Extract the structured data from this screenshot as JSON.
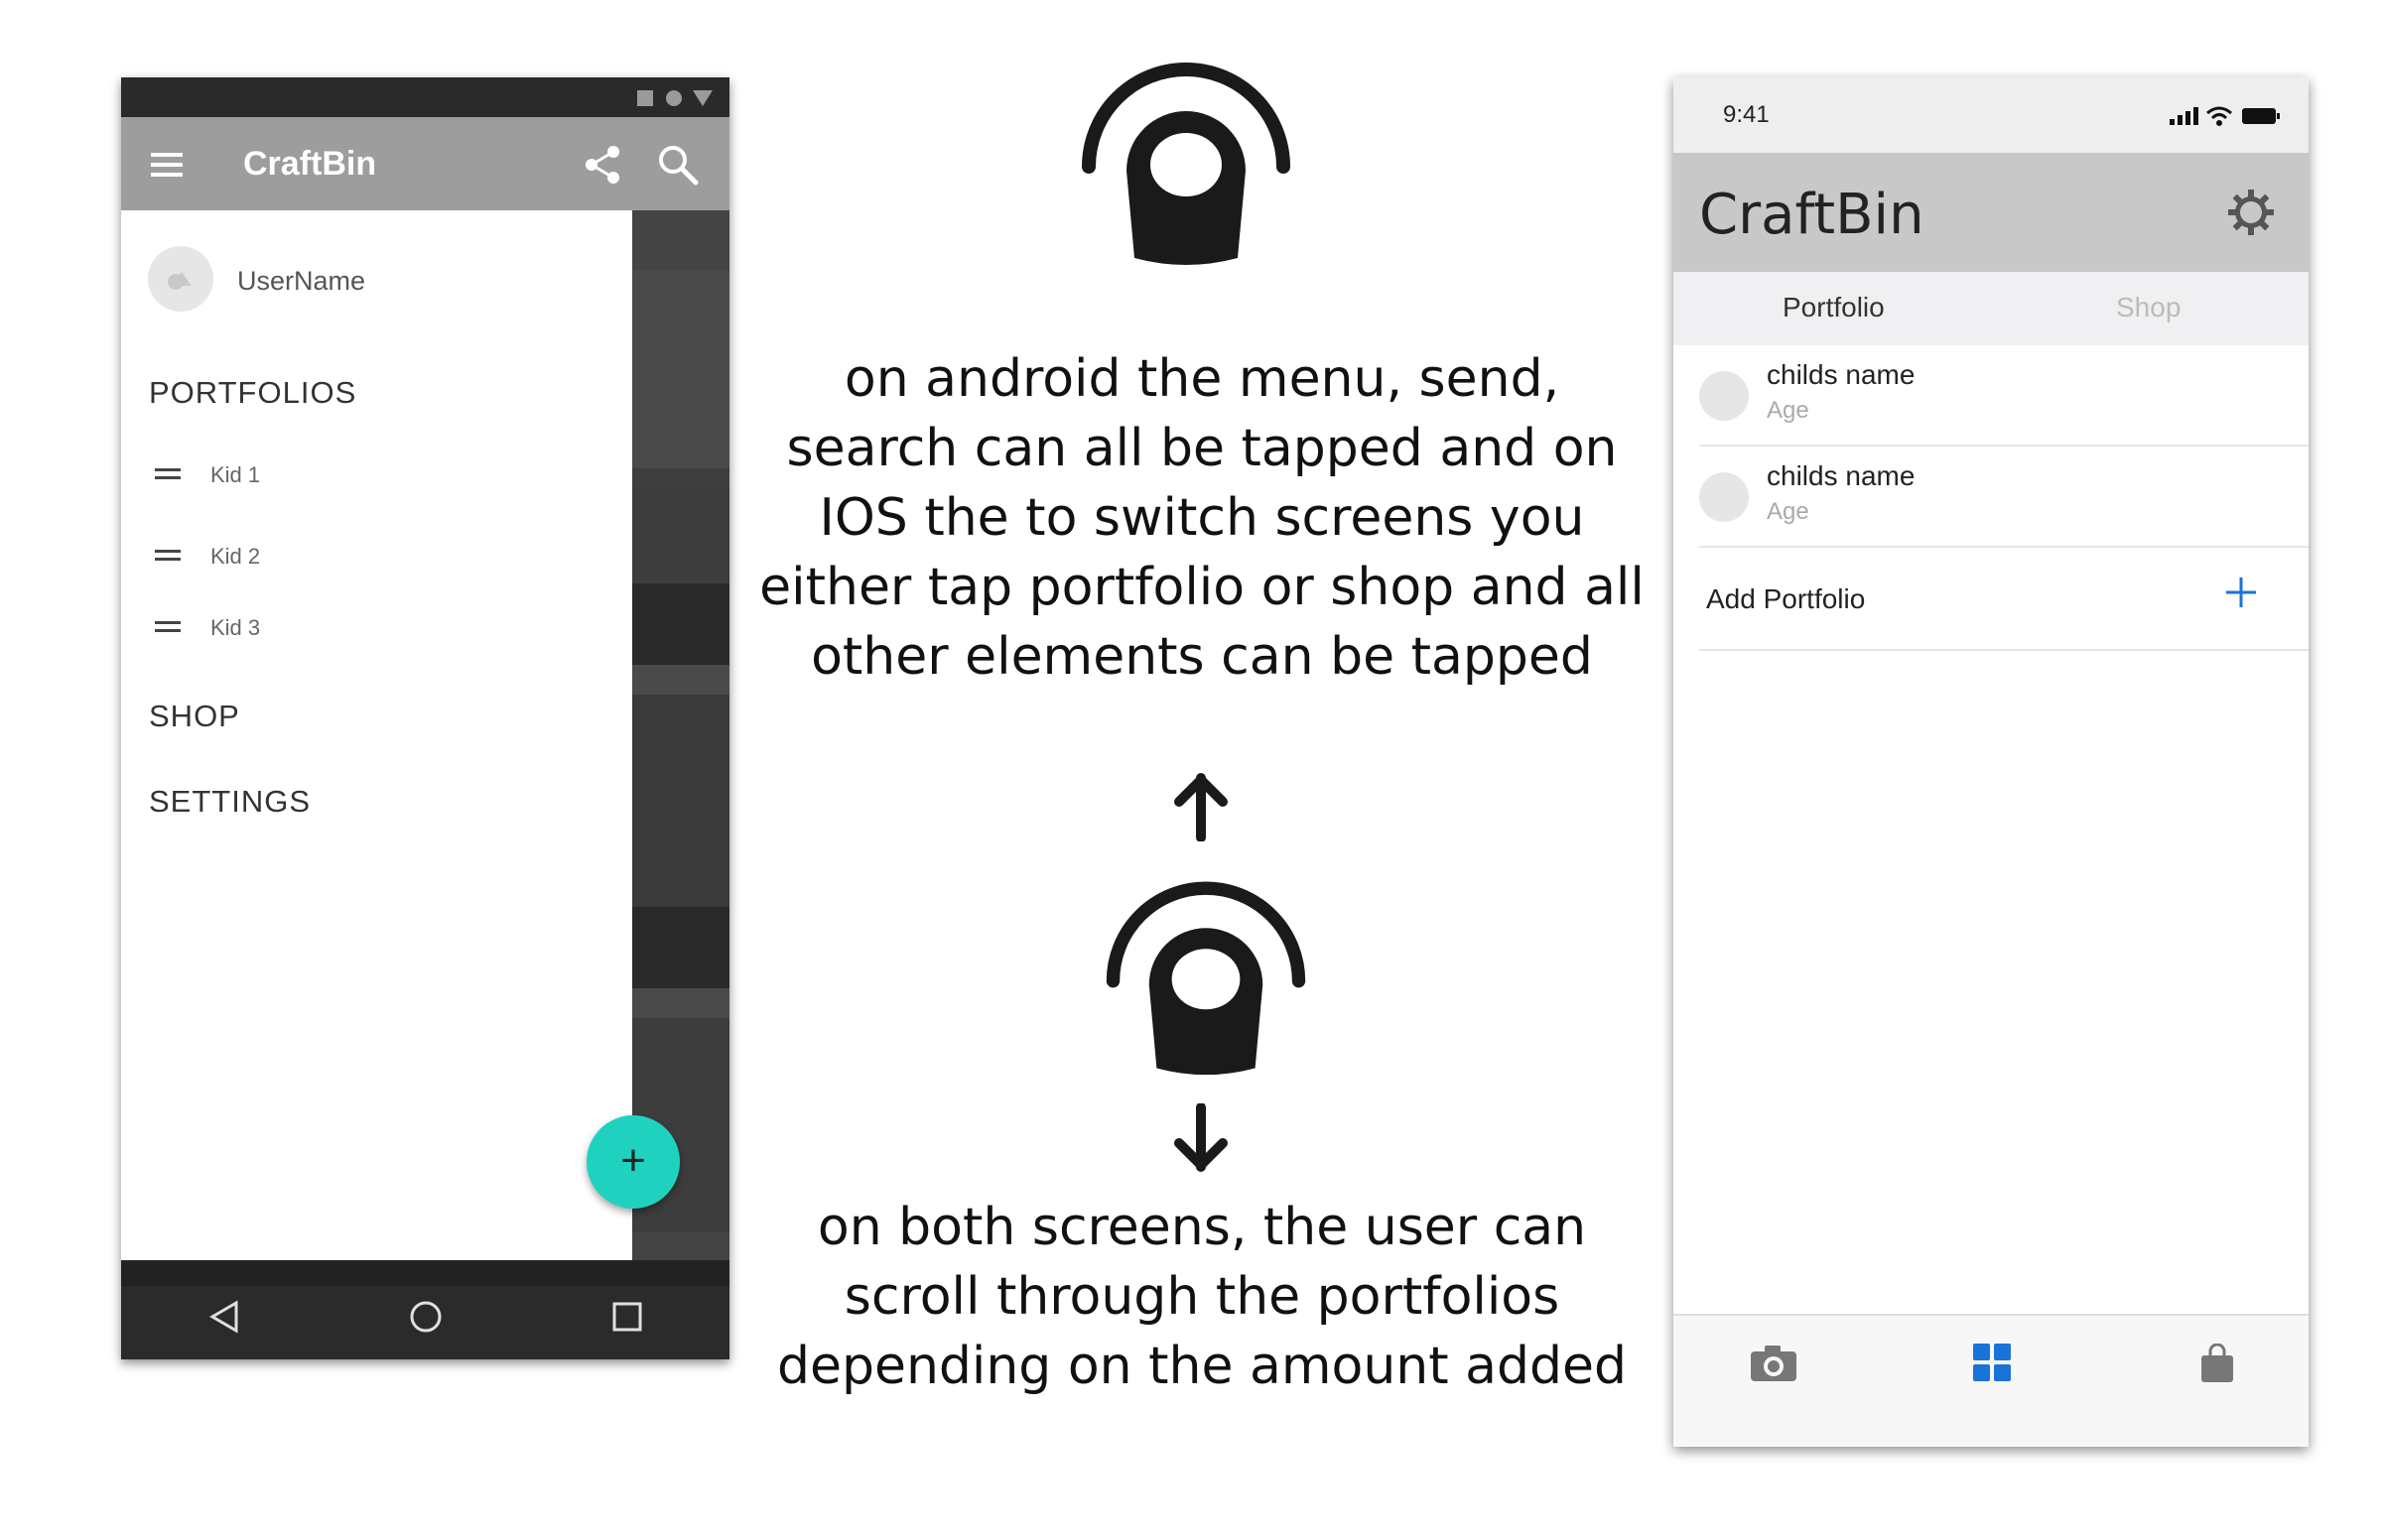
{
  "android": {
    "app_title": "CraftBin",
    "username": "UserName",
    "sections": {
      "portfolios": "PORTFOLIOS",
      "shop": "SHOP",
      "settings": "SETTINGS"
    },
    "kids": [
      "Kid 1",
      "Kid 2",
      "Kid 3"
    ],
    "fab_label": "+",
    "colors": {
      "appbar": "#9d9d9d",
      "fab": "#1fd2c0",
      "drawer": "#ffffff"
    },
    "icons": [
      "menu-icon",
      "share-icon",
      "search-icon",
      "back-nav-icon",
      "home-nav-icon",
      "recents-nav-icon"
    ]
  },
  "notes": {
    "tap_text": "on android the menu, send, search can all be tapped and on IOS the to switch screens you either tap portfolio or shop and all other elements can be tapped",
    "scroll_text": "on both screens, the user can scroll through the portfolios depending on the amount added"
  },
  "ios": {
    "time": "9:41",
    "app_title": "CraftBin",
    "tabs": {
      "portfolio": "Portfolio",
      "shop": "Shop"
    },
    "rows": [
      {
        "name": "childs name",
        "age": "Age"
      },
      {
        "name": "childs name",
        "age": "Age"
      }
    ],
    "add_portfolio": "Add Portfolio",
    "colors": {
      "accent": "#1a73d9",
      "header": "#c8c8c8"
    },
    "icons": [
      "signal-icon",
      "wifi-icon",
      "battery-icon",
      "gear-icon",
      "plus-icon",
      "camera-icon",
      "grid-icon",
      "bag-icon"
    ]
  }
}
